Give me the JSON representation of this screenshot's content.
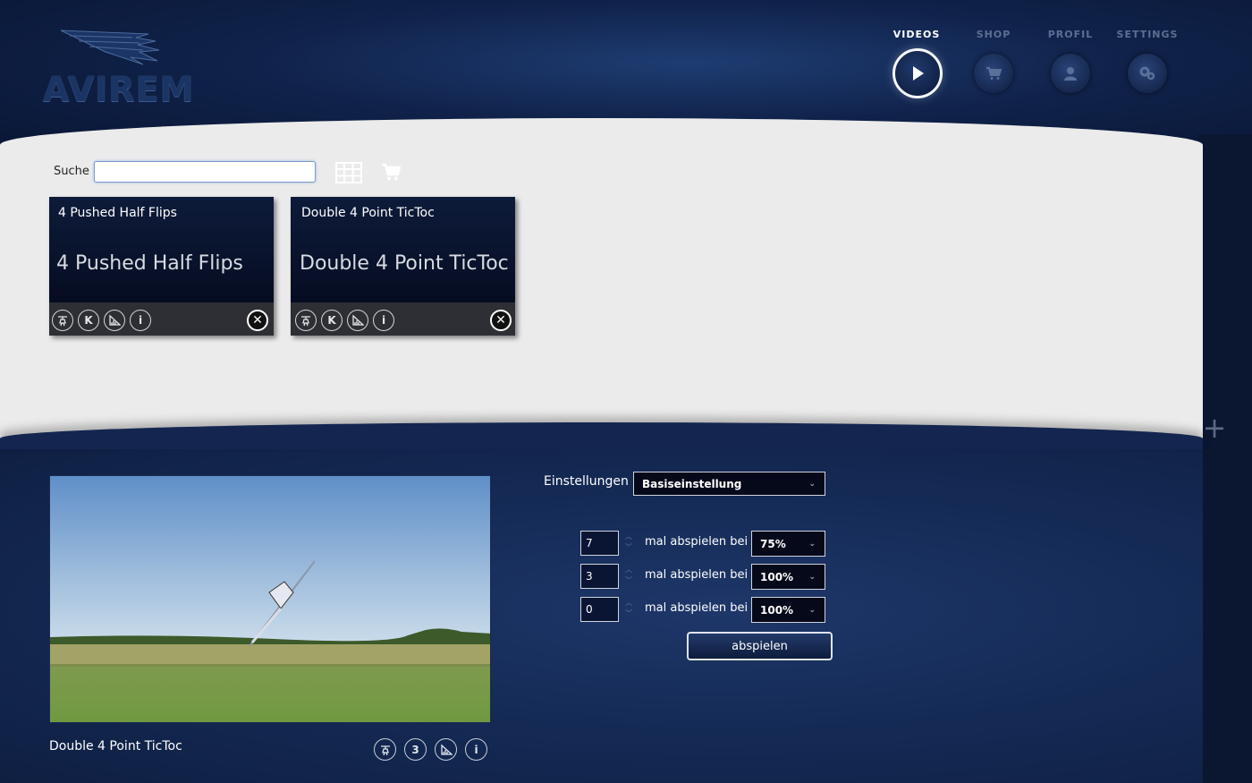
{
  "brand": {
    "logo_text": "AVIREM"
  },
  "nav": {
    "items": [
      {
        "label": "VIDEOS",
        "icon": "play-icon",
        "active": true
      },
      {
        "label": "SHOP",
        "icon": "cart-icon",
        "active": false
      },
      {
        "label": "PROFIL",
        "icon": "user-icon",
        "active": false
      },
      {
        "label": "SETTINGS",
        "icon": "gear-icon",
        "active": false
      }
    ]
  },
  "search": {
    "label": "Suche",
    "value": "",
    "placeholder": ""
  },
  "cards": [
    {
      "small_title": "4 Pushed Half Flips",
      "big_title": "4 Pushed Half Flips",
      "icons": [
        "helicopter-icon",
        "k-badge-icon",
        "chart-icon",
        "info-icon"
      ]
    },
    {
      "small_title": "Double 4 Point TicToc",
      "big_title": "Double 4 Point TicToc",
      "icons": [
        "helicopter-icon",
        "k-badge-icon",
        "chart-icon",
        "info-icon"
      ]
    }
  ],
  "card_icon_glyphs": {
    "k": "K",
    "info": "i",
    "close": "✕"
  },
  "preview": {
    "title": "Double 4 Point TicToc",
    "icon_glyphs": {
      "number": "3",
      "info": "i"
    }
  },
  "settings": {
    "label": "Einstellungen",
    "preset": "Basiseinstellung",
    "rows": [
      {
        "count": "7",
        "label": "mal abspielen bei",
        "speed": "75%"
      },
      {
        "count": "3",
        "label": "mal abspielen bei",
        "speed": "100%"
      },
      {
        "count": "0",
        "label": "mal abspielen bei",
        "speed": "100%"
      }
    ],
    "play_label": "abspielen"
  },
  "colors": {
    "header_bg": "#10224a",
    "content_bg": "#ebebeb",
    "bottom_bg": "#142a55",
    "accent_white": "#ffffff",
    "nav_inactive": "#5c6f93"
  }
}
